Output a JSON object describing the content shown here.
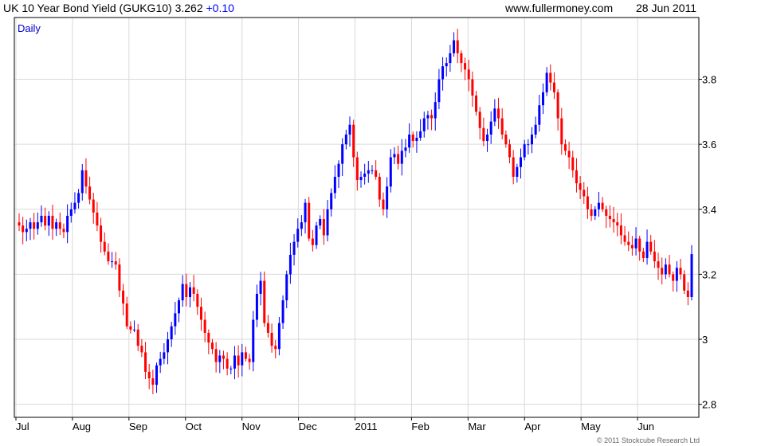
{
  "header": {
    "title": "UK 10 Year Bond Yield (GUKG10) 3.262",
    "change": "+0.10",
    "site": "www.fullermoney.com",
    "date": "28 Jun 2011"
  },
  "footer": {
    "copyright": "© 2011 Stockcube Research Ltd"
  },
  "colors": {
    "up": "#0000ff",
    "down": "#ff0000",
    "grid": "#d9d9d9",
    "frame": "#000000"
  },
  "chart_data": {
    "type": "candlestick",
    "title": "UK 10 Year Bond Yield (GUKG10)",
    "period_label": "Daily",
    "y_axis_side": "right",
    "ylim": [
      2.76,
      3.99
    ],
    "y_ticks": [
      2.8,
      3.0,
      3.2,
      3.4,
      3.6,
      3.8
    ],
    "y_tick_labels": [
      "2.8",
      "3",
      "3.2",
      "3.4",
      "3.6",
      "3.8"
    ],
    "x_labels": [
      "Jul",
      "Aug",
      "Sep",
      "Oct",
      "Nov",
      "Dec",
      "2011",
      "Feb",
      "Mar",
      "Apr",
      "May",
      "Jun"
    ],
    "grid": true,
    "last_close": 3.262,
    "approx_daily_closes": [
      3.35,
      3.33,
      3.34,
      3.36,
      3.34,
      3.36,
      3.38,
      3.35,
      3.38,
      3.34,
      3.36,
      3.34,
      3.33,
      3.38,
      3.4,
      3.42,
      3.45,
      3.52,
      3.47,
      3.43,
      3.39,
      3.35,
      3.3,
      3.27,
      3.24,
      3.24,
      3.23,
      3.15,
      3.11,
      3.04,
      3.03,
      3.03,
      2.98,
      2.96,
      2.9,
      2.88,
      2.86,
      2.92,
      2.94,
      2.96,
      3.0,
      3.04,
      3.08,
      3.12,
      3.17,
      3.13,
      3.16,
      3.14,
      3.1,
      3.06,
      3.02,
      2.99,
      2.97,
      2.93,
      2.95,
      2.94,
      2.91,
      2.91,
      2.95,
      2.92,
      2.96,
      2.94,
      2.93,
      3.06,
      3.14,
      3.18,
      3.05,
      3.02,
      2.98,
      2.97,
      3.05,
      3.12,
      3.2,
      3.26,
      3.3,
      3.34,
      3.36,
      3.42,
      3.31,
      3.29,
      3.35,
      3.37,
      3.32,
      3.4,
      3.45,
      3.5,
      3.54,
      3.6,
      3.63,
      3.66,
      3.56,
      3.49,
      3.5,
      3.51,
      3.52,
      3.52,
      3.5,
      3.43,
      3.4,
      3.47,
      3.56,
      3.57,
      3.54,
      3.58,
      3.59,
      3.63,
      3.61,
      3.62,
      3.64,
      3.68,
      3.69,
      3.68,
      3.73,
      3.8,
      3.84,
      3.85,
      3.88,
      3.92,
      3.88,
      3.85,
      3.83,
      3.8,
      3.75,
      3.7,
      3.65,
      3.61,
      3.63,
      3.67,
      3.71,
      3.68,
      3.63,
      3.6,
      3.56,
      3.5,
      3.53,
      3.56,
      3.6,
      3.6,
      3.63,
      3.66,
      3.72,
      3.76,
      3.82,
      3.79,
      3.76,
      3.68,
      3.6,
      3.58,
      3.56,
      3.52,
      3.48,
      3.46,
      3.44,
      3.4,
      3.38,
      3.4,
      3.42,
      3.4,
      3.38,
      3.37,
      3.36,
      3.35,
      3.32,
      3.3,
      3.29,
      3.28,
      3.31,
      3.27,
      3.25,
      3.3,
      3.27,
      3.24,
      3.22,
      3.2,
      3.23,
      3.2,
      3.18,
      3.22,
      3.2,
      3.15,
      3.13,
      3.262
    ]
  }
}
